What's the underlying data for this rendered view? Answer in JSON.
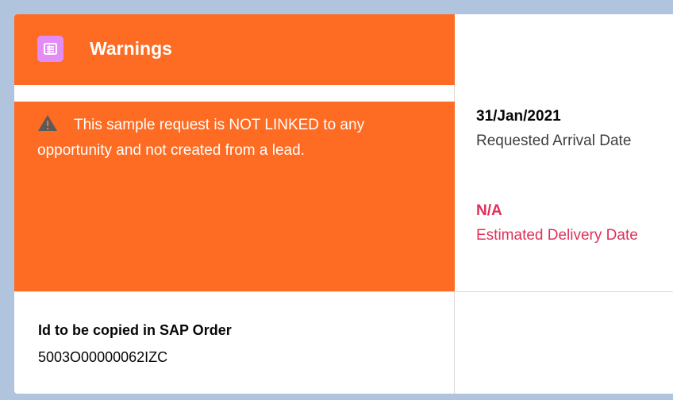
{
  "warnings_card": {
    "title": "Warnings",
    "icon": "list-icon",
    "message": "This sample request is NOT LINKED to any opportunity and not created from a lead.",
    "message_icon": "warning-icon",
    "accent_color": "#fe6b22"
  },
  "requested_arrival": {
    "value": "31/Jan/2021",
    "label": "Requested Arrival Date"
  },
  "estimated_delivery": {
    "value": "N/A",
    "label": "Estimated Delivery Date",
    "color": "#e0305a"
  },
  "sap_order": {
    "label": "Id to be copied in SAP Order",
    "value": "5003O00000062IZC"
  }
}
